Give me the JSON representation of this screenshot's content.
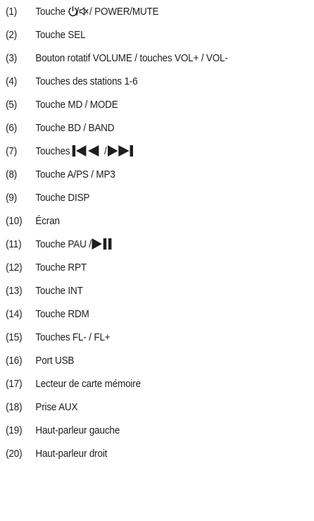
{
  "items": [
    {
      "num": "(1)",
      "before": "Touche ",
      "icon": "power-mute-icon",
      "after": " / POWER/MUTE"
    },
    {
      "num": "(2)",
      "text": "Touche SEL"
    },
    {
      "num": "(3)",
      "text": "Bouton rotatif VOLUME / touches VOL+ / VOL-"
    },
    {
      "num": "(4)",
      "text": "Touches des stations 1-6"
    },
    {
      "num": "(5)",
      "text": "Touche MD / MODE"
    },
    {
      "num": "(6)",
      "text": "Touche BD / BAND"
    },
    {
      "num": "(7)",
      "before": "Touches ",
      "icon": "skip-prev-icon",
      "mid": " / ",
      "icon2": "skip-next-icon",
      "after": ""
    },
    {
      "num": "(8)",
      "text": "Touche A/PS / MP3"
    },
    {
      "num": "(9)",
      "text": "Touche DISP"
    },
    {
      "num": "(10)",
      "text": "Écran"
    },
    {
      "num": "(11)",
      "before": "Touche PAU / ",
      "icon": "play-pause-icon",
      "after": ""
    },
    {
      "num": "(12)",
      "text": "Touche RPT"
    },
    {
      "num": "(13)",
      "text": "Touche INT"
    },
    {
      "num": "(14)",
      "text": "Touche RDM"
    },
    {
      "num": "(15)",
      "text": "Touches FL- / FL+"
    },
    {
      "num": "(16)",
      "text": "Port USB"
    },
    {
      "num": "(17)",
      "text": "Lecteur de carte mémoire"
    },
    {
      "num": "(18)",
      "text": "Prise AUX"
    },
    {
      "num": "(19)",
      "text": "Haut-parleur gauche"
    },
    {
      "num": "(20)",
      "text": "Haut-parleur droit"
    }
  ]
}
